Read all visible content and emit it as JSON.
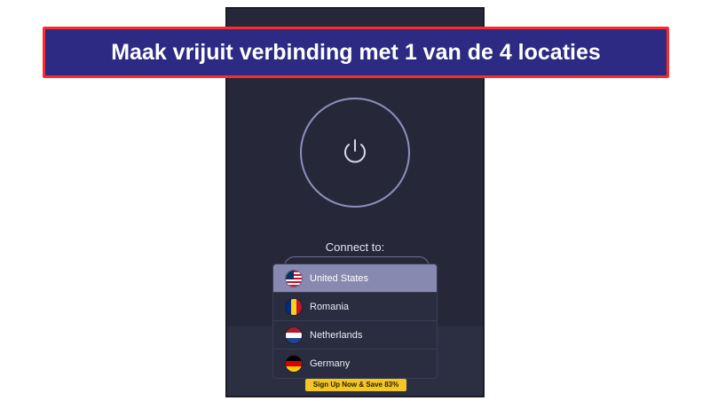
{
  "banner": {
    "text": "Maak vrijuit verbinding met 1 van de 4 locaties",
    "border_color": "#ff2a2a",
    "background_color": "#2c2a82"
  },
  "app": {
    "power_icon": "power-icon",
    "connect_label": "Connect to:",
    "signup_text": "Sign Up Now & Save 83%",
    "accent_color": "#8789b0",
    "signup_color": "#f3c624"
  },
  "locations": {
    "selected": "United States",
    "items": [
      {
        "label": "United States",
        "icon": "us-flag-icon"
      },
      {
        "label": "Romania",
        "icon": "romania-flag-icon"
      },
      {
        "label": "Netherlands",
        "icon": "netherlands-flag-icon"
      },
      {
        "label": "Germany",
        "icon": "germany-flag-icon"
      }
    ]
  }
}
